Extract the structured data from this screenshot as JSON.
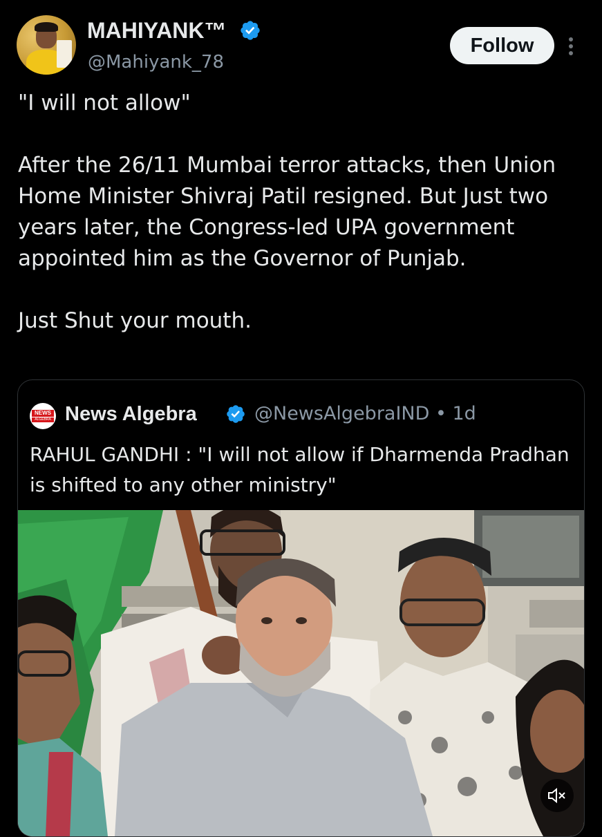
{
  "author": {
    "display_name": "MAHIYANK™",
    "handle": "@Mahiyank_78",
    "verified": true
  },
  "actions": {
    "follow_label": "Follow"
  },
  "tweet": {
    "line1": "\"I will not allow\"",
    "paragraph2": "After the 26/11 Mumbai terror attacks, then Union Home Minister Shivraj Patil resigned. But Just two years later, the Congress-led UPA government appointed him as the Governor of Punjab.",
    "paragraph3": "Just Shut your mouth."
  },
  "quoted": {
    "avatar_text_top": "NEWS",
    "avatar_text_bottom": "ALGEBRA",
    "display_name": "News Algebra",
    "meta": "@NewsAlgebraIND • 1d",
    "text": "RAHUL GANDHI : \"I will not allow if Dharmenda Pradhan is shifted to any other ministry\""
  },
  "icons": {
    "verified": "verified-badge-icon",
    "more": "more-options-icon",
    "mute": "speaker-muted-icon"
  },
  "colors": {
    "background": "#000000",
    "verified_blue": "#1d9bf0",
    "text_primary": "#e7e9ea",
    "text_secondary": "#8b98a5",
    "follow_bg": "#eff3f4"
  }
}
